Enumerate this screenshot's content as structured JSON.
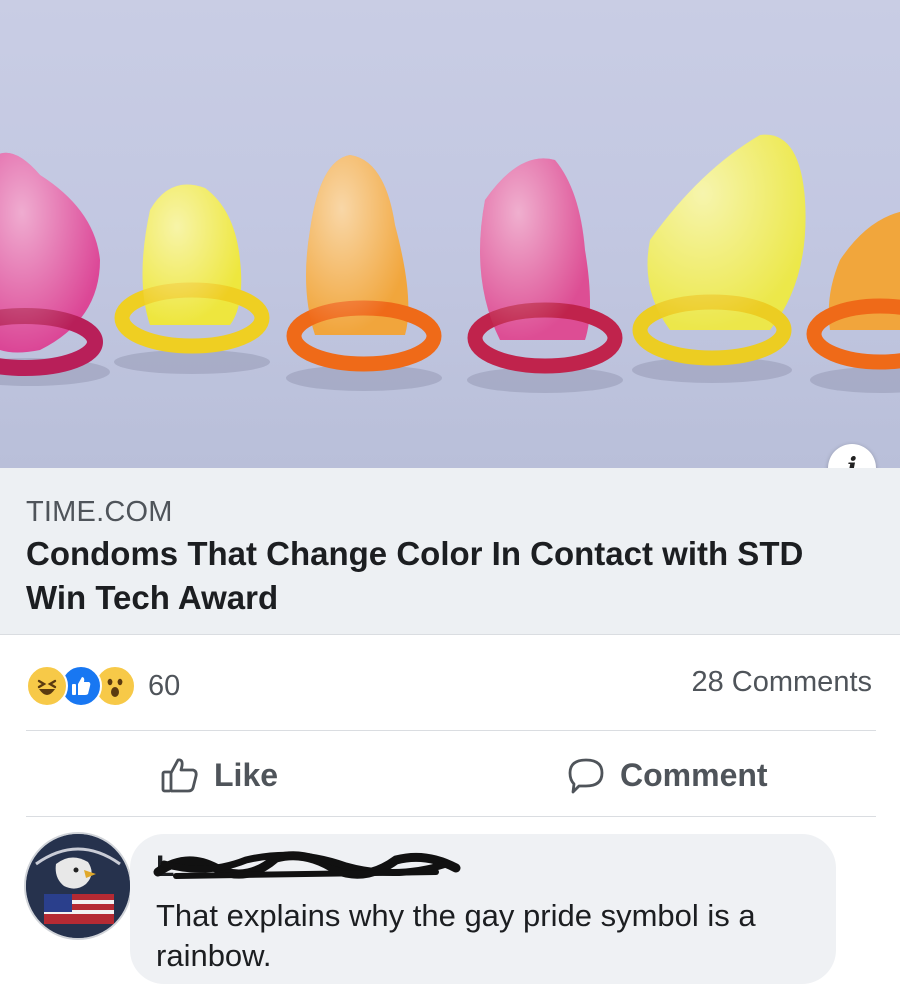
{
  "link": {
    "source": "TIME.COM",
    "headline": "Condoms That Change Color In Contact with STD Win Tech Award",
    "info_icon": "i"
  },
  "reactions": {
    "icons": [
      "haha-reaction-icon",
      "like-reaction-icon",
      "wow-reaction-icon"
    ],
    "count": "60"
  },
  "comments_count": "28 Comments",
  "actions": {
    "like_label": "Like",
    "comment_label": "Comment"
  },
  "comment": {
    "author": "L",
    "text": "That explains why the gay pride symbol is a rainbow."
  },
  "colors": {
    "brand_blue": "#1877f2",
    "meta_bg": "#edf0f3",
    "secondary_text": "#4f545a"
  }
}
